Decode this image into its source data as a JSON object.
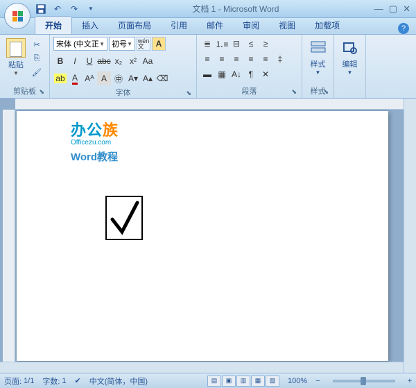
{
  "titlebar": {
    "title": "文档 1 - Microsoft Word"
  },
  "tabs": {
    "home": "开始",
    "insert": "插入",
    "layout": "页面布局",
    "references": "引用",
    "mail": "邮件",
    "review": "审阅",
    "view": "视图",
    "addins": "加载项"
  },
  "ribbon": {
    "clipboard": {
      "paste": "粘贴",
      "label": "剪贴板"
    },
    "font": {
      "name": "宋体 (中文正",
      "size": "初号",
      "label": "字体"
    },
    "paragraph": {
      "label": "段落"
    },
    "styles": {
      "btn": "样式",
      "label": "样式"
    },
    "editing": {
      "btn": "编辑",
      "label": ""
    }
  },
  "watermark": {
    "line1a": "办公",
    "line1b": "族",
    "line2": "Officezu.com",
    "line3": "Word教程"
  },
  "statusbar": {
    "page_label": "页面:",
    "page_val": "1/1",
    "words_label": "字数:",
    "words_val": "1",
    "lang": "中文(简体，中国)",
    "zoom": "100%"
  }
}
